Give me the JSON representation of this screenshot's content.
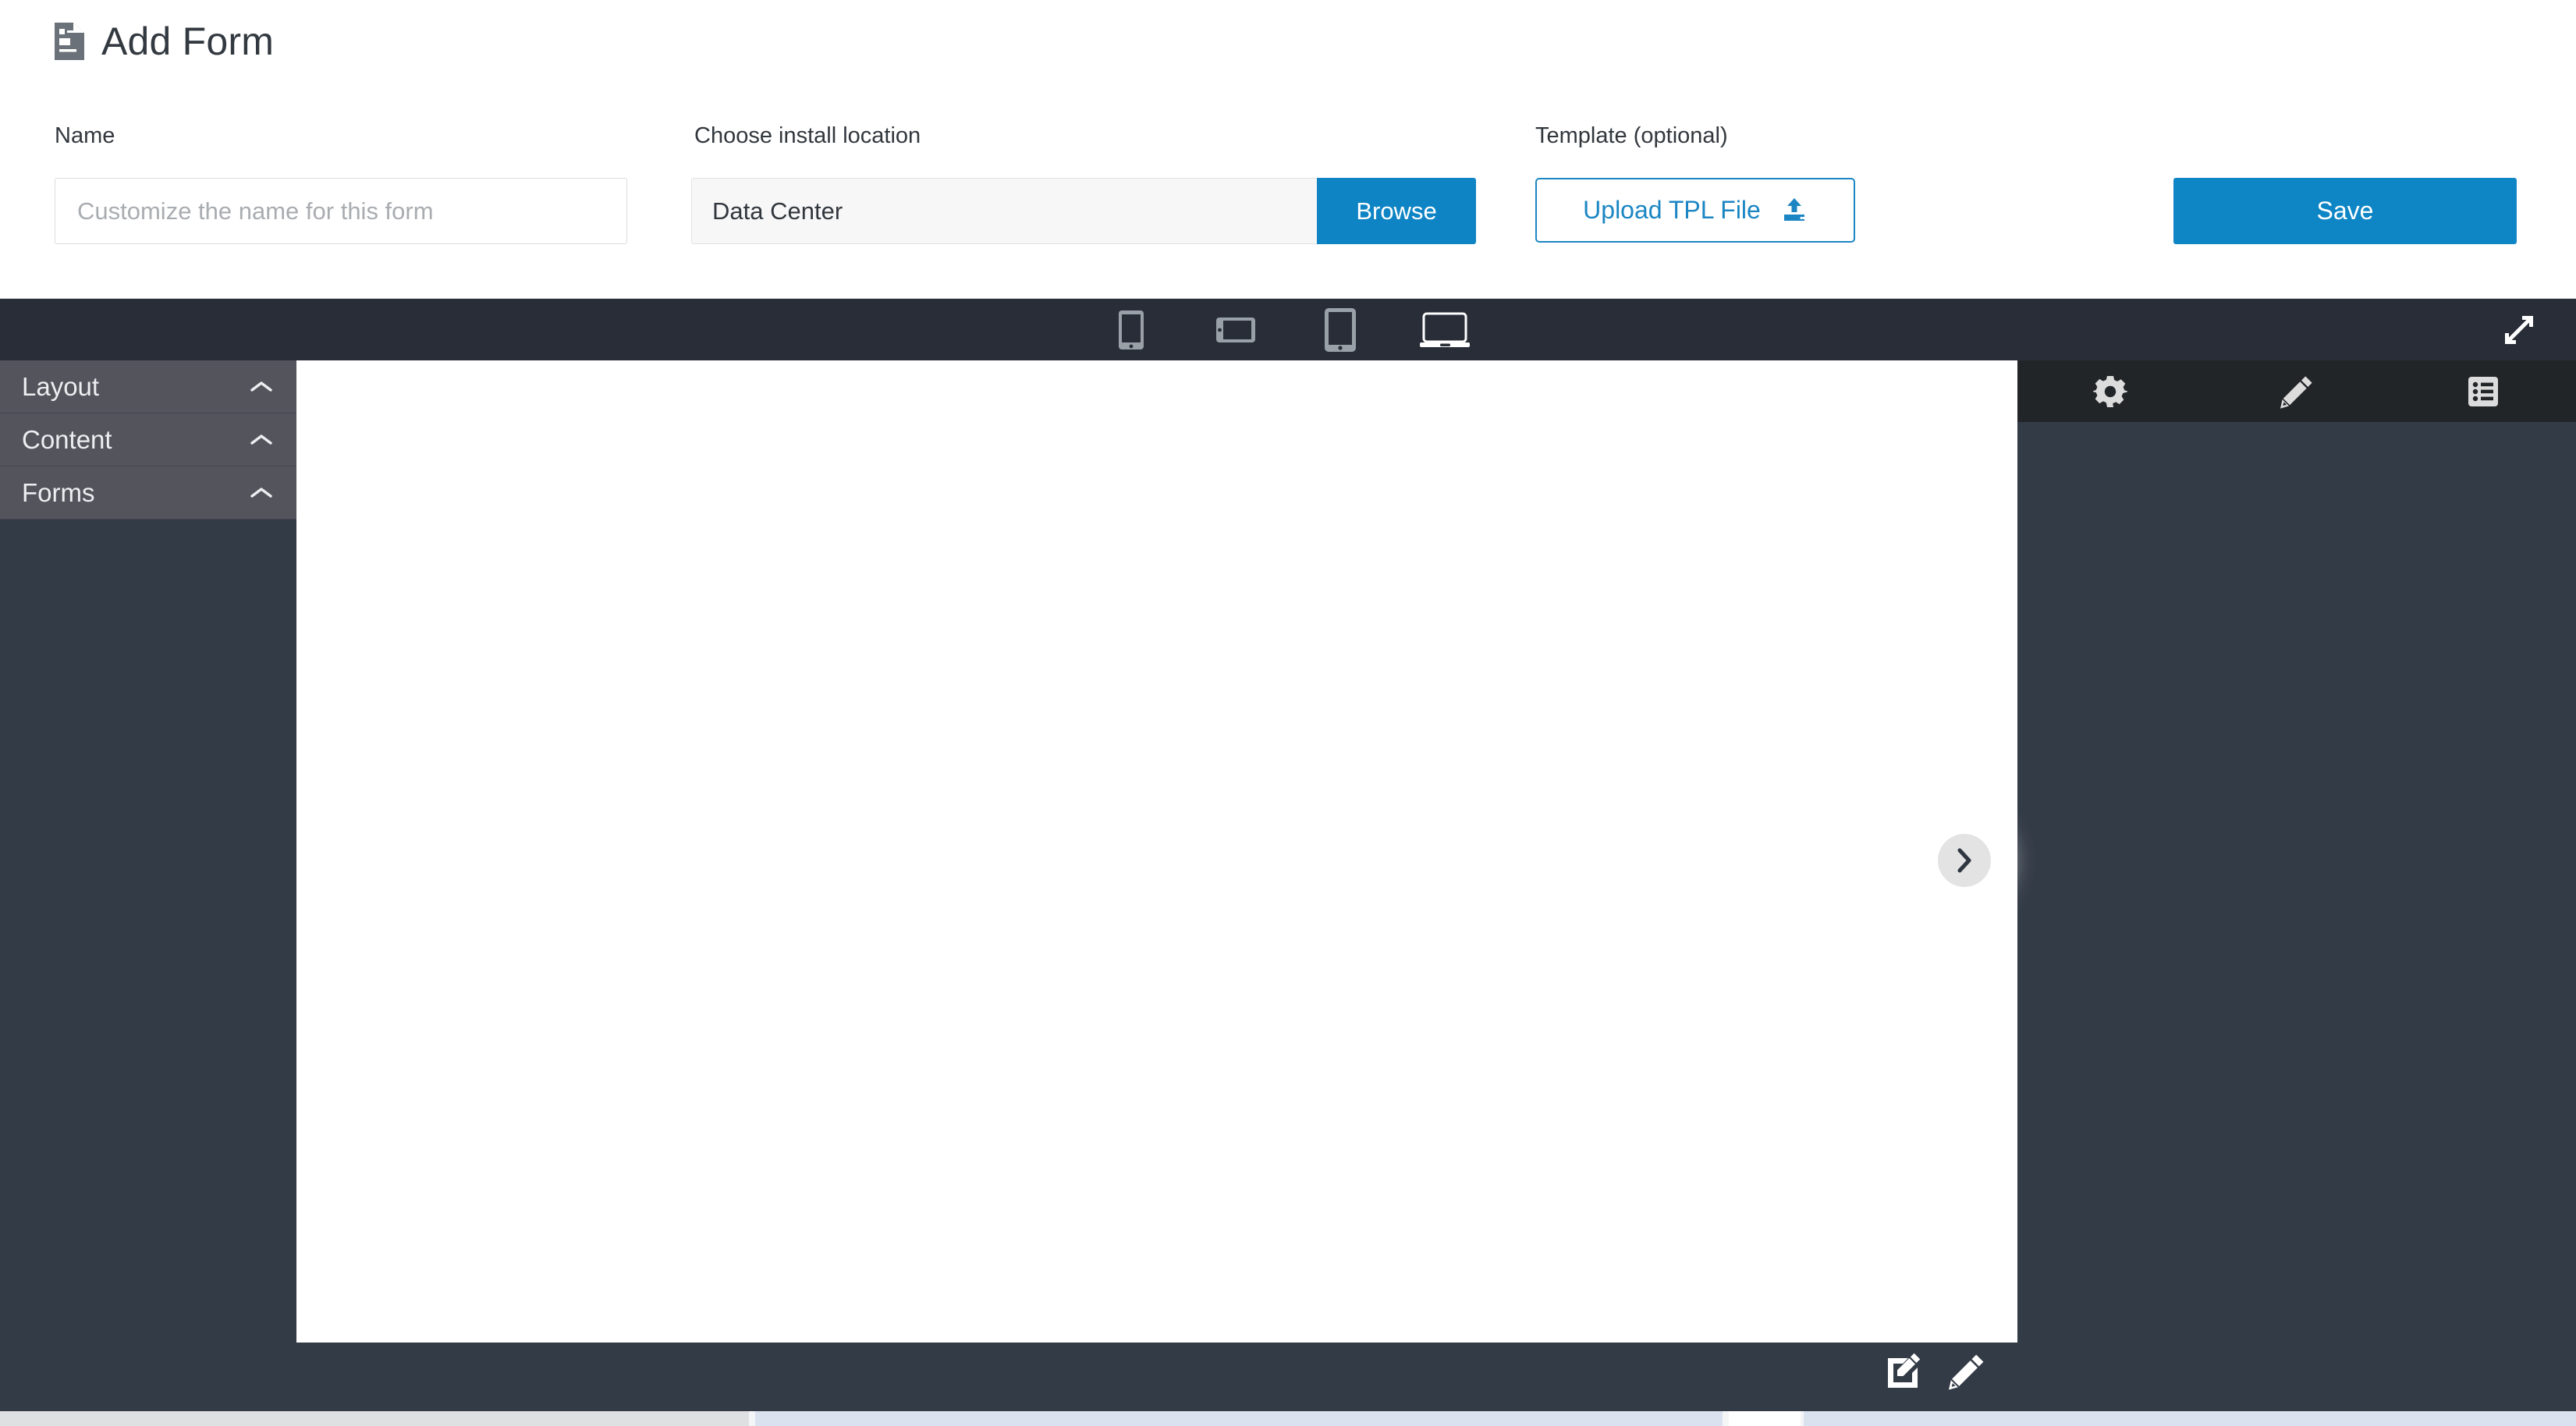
{
  "header": {
    "title": "Add Form",
    "title_icon": "document-form-icon",
    "name_field": {
      "label": "Name",
      "value": "",
      "placeholder": "Customize the name for this form"
    },
    "install_location": {
      "label": "Choose install location",
      "value": "Data Center",
      "browse_label": "Browse"
    },
    "template": {
      "label": "Template (optional)",
      "upload_label": "Upload TPL File",
      "upload_icon": "upload-icon"
    },
    "save_label": "Save"
  },
  "device_bar": {
    "devices": [
      {
        "name": "mobile-portrait",
        "active": false
      },
      {
        "name": "mobile-landscape",
        "active": false
      },
      {
        "name": "tablet-portrait",
        "active": false
      },
      {
        "name": "desktop",
        "active": true
      }
    ],
    "expand_icon": "expand-arrows-icon"
  },
  "sidebar": {
    "sections": [
      {
        "label": "Layout",
        "chevron": "chevron-up-icon"
      },
      {
        "label": "Content",
        "chevron": "chevron-up-icon"
      },
      {
        "label": "Forms",
        "chevron": "chevron-up-icon"
      }
    ]
  },
  "tool_strip": {
    "tools": [
      {
        "name": "settings",
        "icon": "gear-icon"
      },
      {
        "name": "edit",
        "icon": "pencil-icon"
      },
      {
        "name": "list",
        "icon": "list-icon"
      }
    ]
  },
  "canvas": {
    "next_icon": "chevron-right-icon",
    "bottom_tools": [
      {
        "name": "edit-box",
        "icon": "pencil-square-icon"
      },
      {
        "name": "edit",
        "icon": "pencil-icon"
      }
    ]
  },
  "colors": {
    "accent_blue": "#0e85c5",
    "link_blue": "#1b86c3",
    "editor_bg": "#333b47",
    "device_bar_bg": "#282d38",
    "accordion_bg": "#54545c",
    "tool_strip_bg": "#222528",
    "canvas_bg": "#ffffff"
  }
}
